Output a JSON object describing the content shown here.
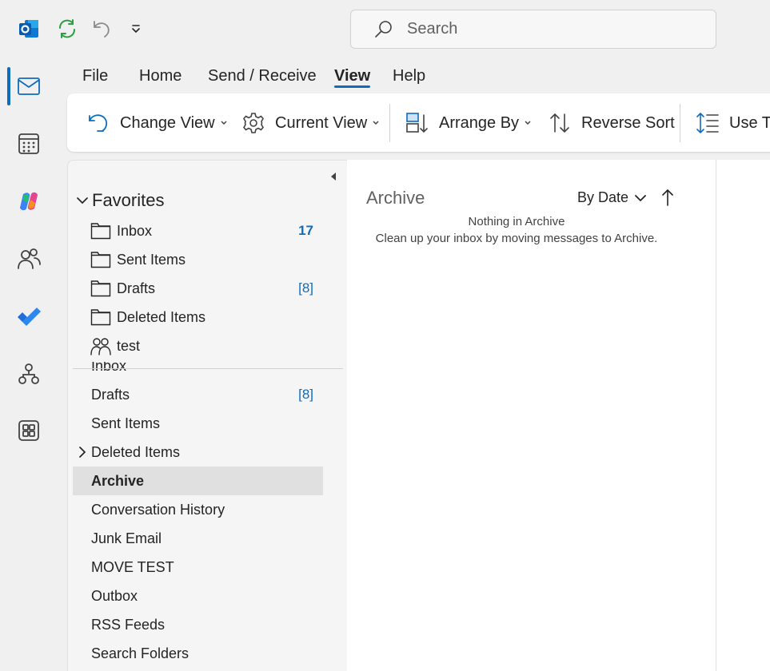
{
  "colors": {
    "accent": "#0f6cbd",
    "ribbon_bg": "#ffffff",
    "app_bg": "#f0f0f0",
    "selected_row": "#e0e0e0"
  },
  "quick_access": [
    {
      "icon": "outlook-logo-icon"
    },
    {
      "icon": "sync-icon"
    },
    {
      "icon": "undo-icon"
    },
    {
      "icon": "customize-qat-chevron-icon"
    }
  ],
  "search": {
    "placeholder": "Search"
  },
  "app_rail": [
    {
      "icon": "mail-icon",
      "active": true
    },
    {
      "icon": "calendar-icon"
    },
    {
      "icon": "copilot-icon"
    },
    {
      "icon": "people-icon"
    },
    {
      "icon": "todo-icon"
    },
    {
      "icon": "org-explorer-icon"
    },
    {
      "icon": "more-apps-icon"
    }
  ],
  "menu": {
    "tabs": [
      "File",
      "Home",
      "Send / Receive",
      "View",
      "Help"
    ],
    "active": "View"
  },
  "ribbon": {
    "change_view": "Change View",
    "current_view": "Current View",
    "arrange_by": "Arrange By",
    "reverse_sort": "Reverse Sort",
    "use_tighter": "Use Ti"
  },
  "folder_pane": {
    "favorites_label": "Favorites",
    "favorites": [
      {
        "name": "Inbox",
        "count": "17",
        "icon": "folder-icon"
      },
      {
        "name": "Sent Items",
        "count": "",
        "icon": "folder-icon"
      },
      {
        "name": "Drafts",
        "count": "[8]",
        "icon": "folder-icon"
      },
      {
        "name": "Deleted Items",
        "count": "",
        "icon": "folder-icon"
      },
      {
        "name": "test",
        "count": "",
        "icon": "group-icon"
      }
    ],
    "clipped_label": "Inbox",
    "folders": [
      {
        "name": "Drafts",
        "count": "[8]"
      },
      {
        "name": "Sent Items",
        "count": ""
      },
      {
        "name": "Deleted Items",
        "count": "",
        "expandable": true
      },
      {
        "name": "Archive",
        "count": "",
        "selected": true
      },
      {
        "name": "Conversation History",
        "count": ""
      },
      {
        "name": "Junk Email",
        "count": ""
      },
      {
        "name": "MOVE TEST",
        "count": ""
      },
      {
        "name": "Outbox",
        "count": ""
      },
      {
        "name": "RSS Feeds",
        "count": ""
      },
      {
        "name": "Search Folders",
        "count": ""
      }
    ]
  },
  "message_list": {
    "title": "Archive",
    "sort_label": "By Date",
    "empty_title": "Nothing in Archive",
    "empty_body": "Clean up your inbox by moving messages to Archive."
  }
}
